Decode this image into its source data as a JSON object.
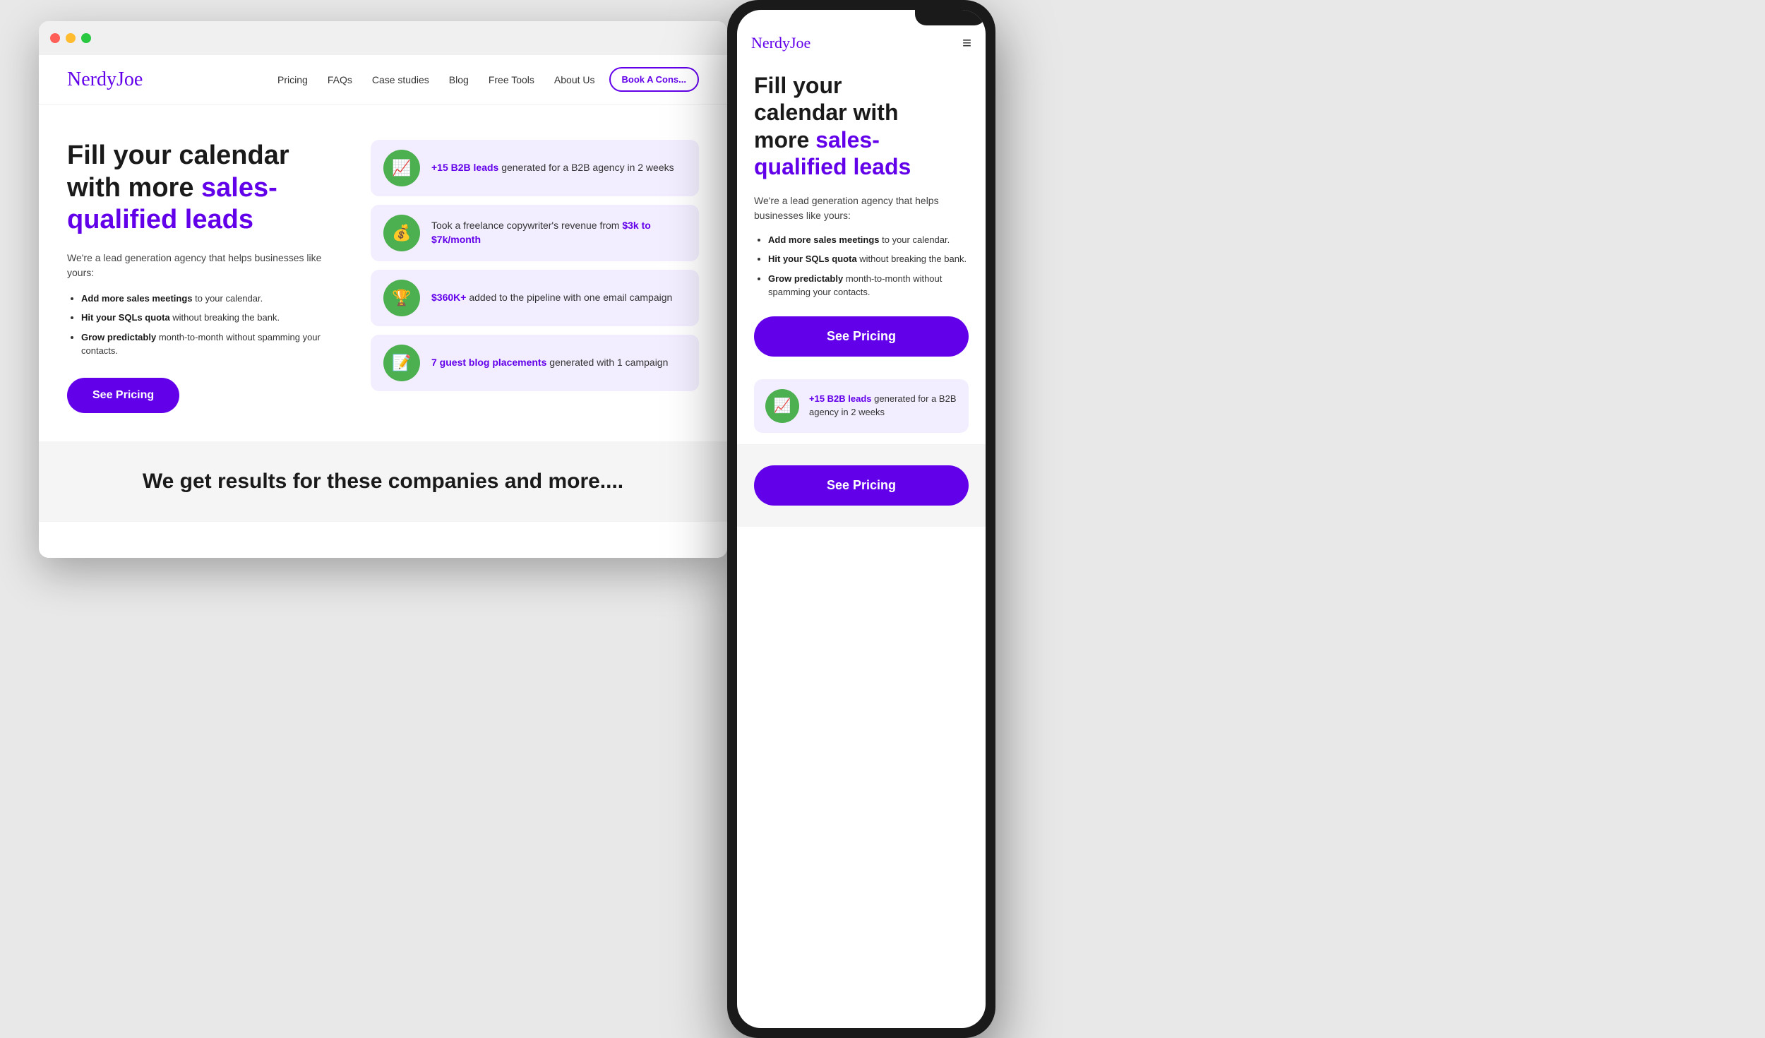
{
  "browser": {
    "traffic_lights": [
      "red",
      "yellow",
      "green"
    ]
  },
  "website": {
    "nav": {
      "logo": "NerdyJoe",
      "links": [
        "Pricing",
        "FAQs",
        "Case studies",
        "Blog",
        "Free Tools",
        "About Us"
      ],
      "cta": "Book A Cons..."
    },
    "hero": {
      "title_line1": "Fill your calendar",
      "title_line2": "with more ",
      "title_accent": "sales-qualified leads",
      "description": "We're a lead generation agency that helps businesses like yours:",
      "bullets": [
        {
          "bold": "Add more sales meetings",
          "rest": " to your calendar."
        },
        {
          "bold": "Hit your SQLs quota",
          "rest": " without breaking the bank."
        },
        {
          "bold": "Grow predictably",
          "rest": " month-to-month without spamming your contacts."
        }
      ],
      "cta_button": "See Pricing"
    },
    "stats": [
      {
        "icon": "📈",
        "icon_color": "#4caf50",
        "highlight": "+15 B2B leads",
        "text": " generated for a B2B agency in 2 weeks"
      },
      {
        "icon": "💰",
        "icon_color": "#4caf50",
        "text_before": "Took a freelance copywriter's revenue from ",
        "highlight": "$3k to $7k/month",
        "text_after": ""
      },
      {
        "icon": "🏆",
        "icon_color": "#4caf50",
        "highlight": "$360K+",
        "text": " added to the pipeline with one email campaign"
      },
      {
        "icon": "📝",
        "icon_color": "#4caf50",
        "highlight": "7 guest blog placements",
        "text": " generated with 1 campaign"
      }
    ],
    "results_section": {
      "title": "We get results for these companies and more...."
    }
  },
  "mobile": {
    "logo": "NerdyJoe",
    "hamburger": "≡",
    "hero": {
      "title_line1": "Fill your",
      "title_line2": "calendar with",
      "title_line3": "more ",
      "title_accent": "sales-qualified leads",
      "description": "We're a lead generation agency that helps businesses like yours:",
      "bullets": [
        {
          "bold": "Add more sales meetings",
          "rest": " to your calendar."
        },
        {
          "bold": "Hit your SQLs quota",
          "rest": " without breaking the bank."
        },
        {
          "bold": "Grow predictably",
          "rest": " month-to-month without spamming your contacts."
        }
      ],
      "cta_button": "See Pricing"
    },
    "stats": [
      {
        "icon": "📈",
        "icon_color": "#4caf50",
        "highlight": "+15 B2B leads",
        "text": " generated for a B2B agency in 2 weeks"
      }
    ],
    "see_pricing_button": "See Pricing"
  }
}
